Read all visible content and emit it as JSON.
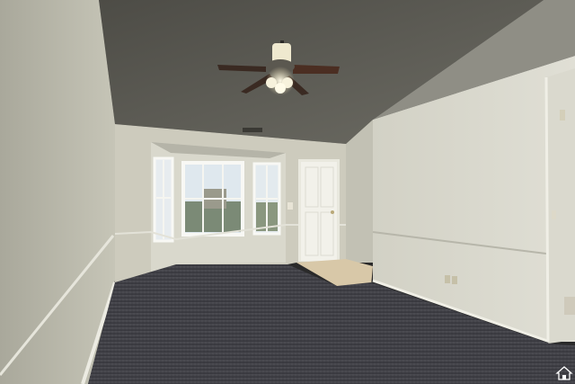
{
  "scene": {
    "subject": "empty-room-interior",
    "icon": "home-icon"
  },
  "colors": {
    "ceiling": "#5e5d56",
    "left_wall": "#bdbcae",
    "back_wall": "#cfcdbf",
    "right_wall": "#d6d5ca",
    "carpet": "#3f3f45",
    "tile": "#d8c8a8",
    "door": "#f2f1ea",
    "trim": "#e9e8de",
    "fan_blade": "#4b2e22"
  }
}
